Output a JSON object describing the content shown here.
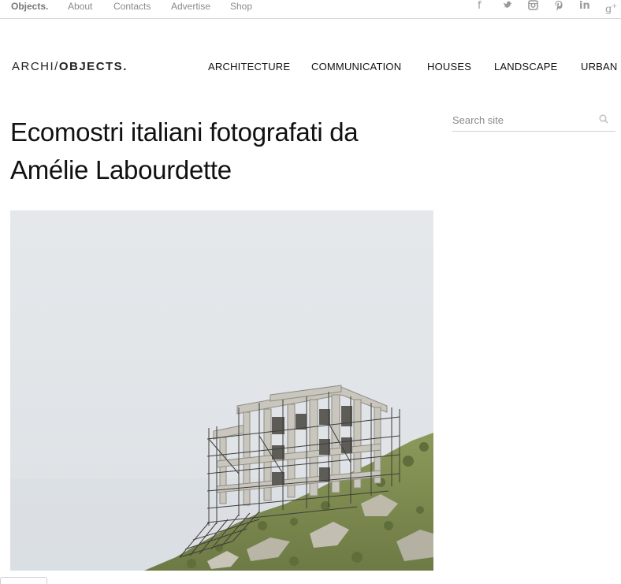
{
  "topbar": {
    "links": [
      "Objects.",
      "About",
      "Contacts",
      "Advertise",
      "Shop"
    ],
    "social": [
      "facebook-icon",
      "twitter-icon",
      "instagram-icon",
      "pinterest-icon",
      "linkedin-icon",
      "googleplus-icon"
    ]
  },
  "header": {
    "logo_left": "ARCHI",
    "logo_slash": "/",
    "logo_right": "OBJECTS.",
    "nav": [
      "ARCHITECTURE",
      "COMMUNICATION",
      "HOUSES",
      "LANDSCAPE",
      "URBAN"
    ]
  },
  "article": {
    "title_line1": "Ecomostri italiani fotografati da",
    "title_line2": "Amélie Labourdette"
  },
  "search": {
    "placeholder": "Search site"
  }
}
